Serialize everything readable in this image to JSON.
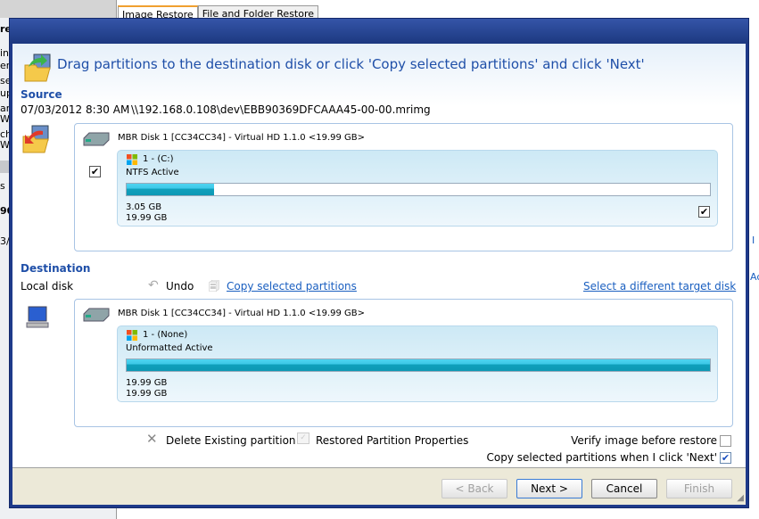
{
  "background": {
    "left_fragments": [
      "re",
      "ind",
      "em",
      "se",
      "up",
      "ar",
      "W",
      "ch",
      "Wi",
      "s",
      "90",
      "3/"
    ],
    "right_fragments": [
      "I",
      "Ac"
    ],
    "tabs": [
      {
        "label": "Image Restore",
        "active": true
      },
      {
        "label": "File and Folder Restore",
        "active": false
      }
    ]
  },
  "dialog": {
    "heading": "Drag partitions to the destination disk or click 'Copy selected partitions' and click 'Next'",
    "source": {
      "label": "Source",
      "date": "07/03/2012 8:30 AM",
      "path": "\\\\192.168.0.108\\dev\\EBB90369DFCAAA45-00-00.mrimg",
      "disk": "MBR Disk 1 [CC34CC34] - Virtual HD 1.1.0  <19.99 GB>",
      "disk_checked": true,
      "partition": {
        "name": "1 -  (C:)",
        "fs": "NTFS Active",
        "used": "3.05 GB",
        "total": "19.99 GB",
        "used_fraction": 0.15,
        "checked": true
      }
    },
    "destination": {
      "label": "Destination",
      "type": "Local disk",
      "undo": "Undo",
      "copy_link": "Copy selected partitions",
      "select_link": "Select a different target disk",
      "disk": "MBR Disk 1 [CC34CC34] - Virtual HD 1.1.0  <19.99 GB>",
      "partition": {
        "name": "1 -  (None)",
        "fs": "Unformatted Active",
        "used": "19.99 GB",
        "total": "19.99 GB",
        "used_fraction": 1.0
      }
    },
    "actions": {
      "delete": "Delete Existing partition",
      "properties": "Restored Partition Properties",
      "verify": "Verify image before restore",
      "verify_checked": false,
      "copy_on_next": "Copy selected partitions when I click 'Next'",
      "copy_on_next_checked": true
    },
    "buttons": {
      "back": "< Back",
      "next": "Next >",
      "cancel": "Cancel",
      "finish": "Finish"
    },
    "colors": {
      "accent": "#1f4fa8",
      "link": "#1a5fc0",
      "bar": "#10a0bc",
      "titlebar": "#1c3880"
    }
  }
}
